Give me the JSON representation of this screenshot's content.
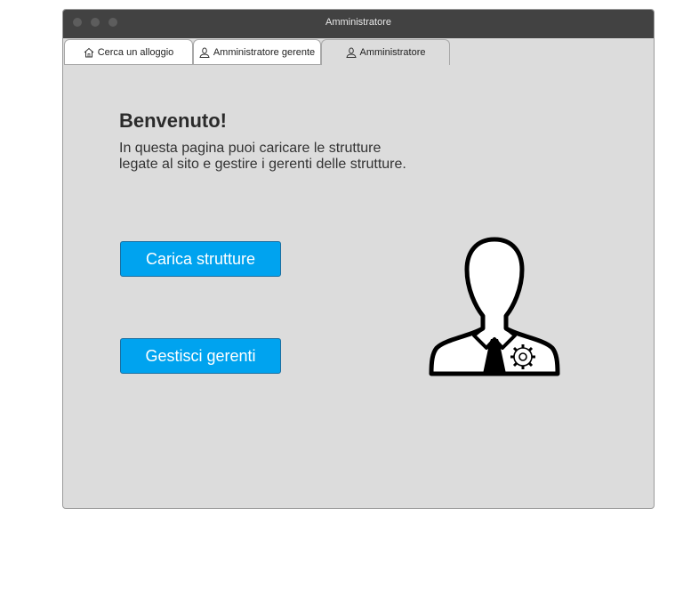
{
  "window": {
    "title": "Amministratore"
  },
  "tabs": [
    {
      "label": "Cerca un alloggio",
      "icon": "home-icon"
    },
    {
      "label": "Amministratore gerente",
      "icon": "user-icon"
    },
    {
      "label": "Amministratore",
      "icon": "user-icon"
    }
  ],
  "main": {
    "welcome": "Benvenuto!",
    "description_line1": "In questa pagina puoi caricare le strutture",
    "description_line2": "legate al sito e gestire i gerenti delle strutture.",
    "buttons": {
      "upload": "Carica strutture",
      "manage": "Gestisci gerenti"
    },
    "illustration": "admin-user-gear-icon"
  },
  "colors": {
    "accent": "#00a3ef",
    "titlebar": "#424242",
    "panel": "#dcdcdc"
  }
}
